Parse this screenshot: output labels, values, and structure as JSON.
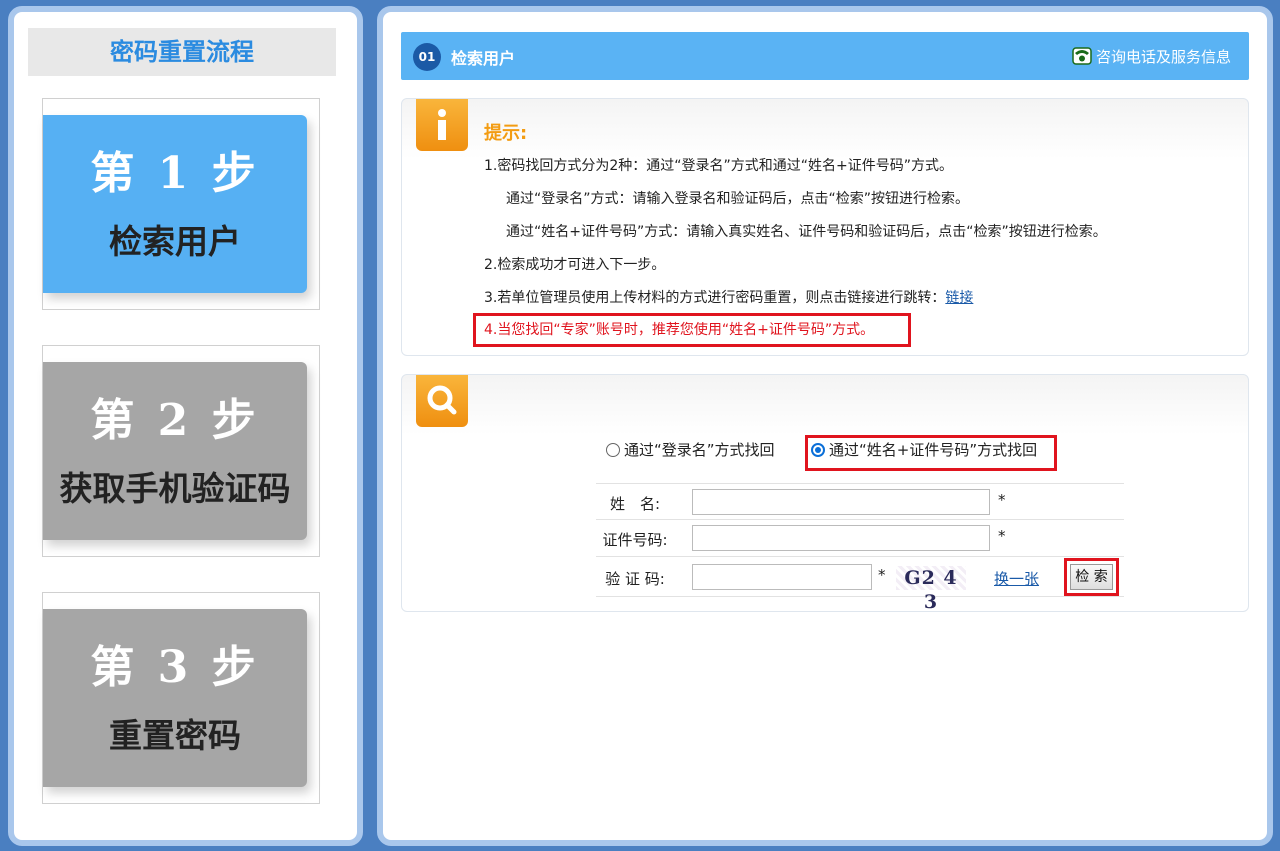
{
  "sidebar": {
    "title": "密码重置流程",
    "steps": [
      {
        "num": "第 1 步",
        "label": "检索用户",
        "state": "active"
      },
      {
        "num": "第 2 步",
        "label": "获取手机验证码",
        "state": "inactive"
      },
      {
        "num": "第 3 步",
        "label": "重置密码",
        "state": "inactive"
      }
    ]
  },
  "header": {
    "badge": "01",
    "title": "检索用户",
    "contact": "咨询电话及服务信息",
    "contact_icon": "phone-icon"
  },
  "tips": {
    "icon": "info-icon",
    "title": "提示:",
    "lines": [
      "1.密码找回方式分为2种：通过“登录名”方式和通过“姓名+证件号码”方式。",
      "通过“登录名”方式：请输入登录名和验证码后，点击“检索”按钮进行检索。",
      "通过“姓名+证件号码”方式：请输入真实姓名、证件号码和验证码后，点击“检索”按钮进行检索。",
      "2.检索成功才可进入下一步。",
      "3.若单位管理员使用上传材料的方式进行密码重置，则点击链接进行跳转："
    ],
    "link_text": "链接",
    "highlight": "4.当您找回“专家”账号时，推荐您使用“姓名+证件号码”方式。"
  },
  "search": {
    "icon": "search-icon",
    "radio_login": "通过“登录名”方式找回",
    "radio_name_id": "通过“姓名+证件号码”方式找回",
    "selected": "name_id",
    "name_label": "姓　名:",
    "id_label": "证件号码:",
    "captcha_label": "验 证 码:",
    "required_mark": "*",
    "captcha_text": "G2 4 3",
    "refresh_link": "换一张",
    "search_button": "检 索"
  },
  "colors": {
    "accent_blue": "#5ab3f4",
    "step_active": "#56b0f3",
    "step_inactive": "#a6a6a6",
    "warning_red": "#e0141e",
    "tip_orange": "#f39c12"
  }
}
